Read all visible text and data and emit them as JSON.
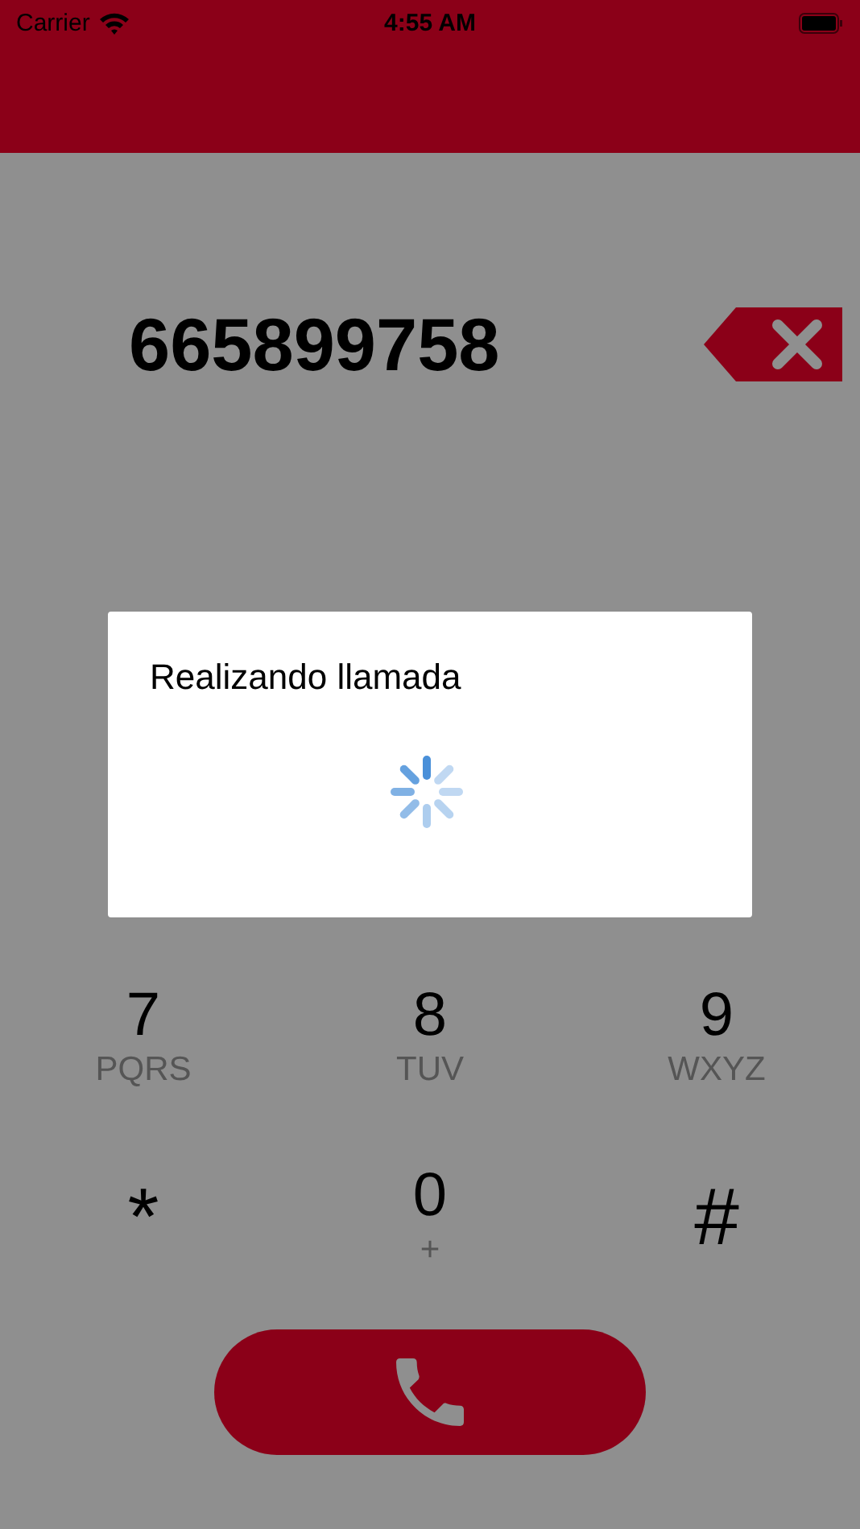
{
  "status_bar": {
    "carrier": "Carrier",
    "time": "4:55 AM"
  },
  "dialer": {
    "number": "665899758"
  },
  "keypad": {
    "keys": [
      {
        "digit": "7",
        "letters": "PQRS",
        "kind": "digit"
      },
      {
        "digit": "8",
        "letters": "TUV",
        "kind": "digit"
      },
      {
        "digit": "9",
        "letters": "WXYZ",
        "kind": "digit"
      },
      {
        "digit": "*",
        "kind": "symbol"
      },
      {
        "digit": "0",
        "letters": "+",
        "kind": "digit"
      },
      {
        "digit": "#",
        "kind": "symbol"
      }
    ]
  },
  "dialog": {
    "title": "Realizando llamada"
  }
}
